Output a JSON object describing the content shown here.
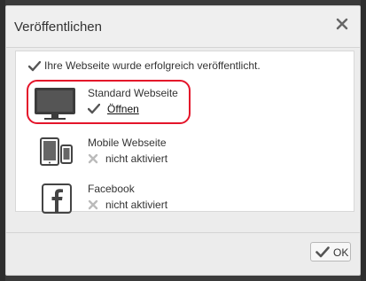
{
  "dialog": {
    "title": "Veröffentlichen",
    "close_icon": "close-icon"
  },
  "message": {
    "text": "Ihre Webseite wurde erfolgreich veröffentlicht.",
    "icon": "checkmark-icon"
  },
  "targets": [
    {
      "name": "Standard Webseite",
      "status": "Öffnen",
      "status_icon": "checkmark-icon",
      "icon": "monitor-icon",
      "highlighted": true
    },
    {
      "name": "Mobile Webseite",
      "status": "nicht aktiviert",
      "status_icon": "x-icon",
      "icon": "tablet-phone-icon"
    },
    {
      "name": "Facebook",
      "status": "nicht aktiviert",
      "status_icon": "x-icon",
      "icon": "facebook-icon"
    }
  ],
  "footer": {
    "ok_label": "OK",
    "ok_icon": "checkmark-icon"
  },
  "colors": {
    "highlight": "#e4142a"
  }
}
